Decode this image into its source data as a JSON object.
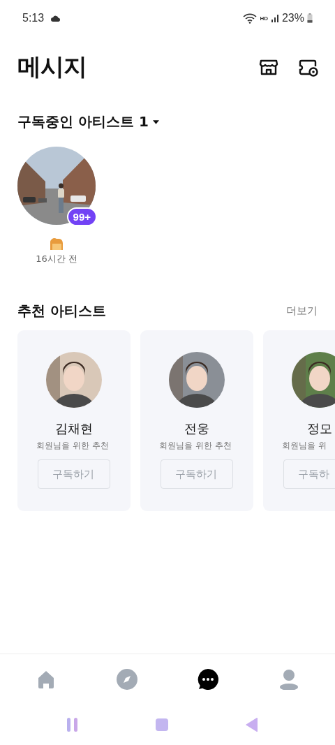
{
  "status_bar": {
    "time": "5:13",
    "hd_label": "HD",
    "battery": "23%"
  },
  "header": {
    "title": "메시지"
  },
  "subscribed": {
    "title": "구독중인 아티스트 1",
    "artists": [
      {
        "kind": "picture",
        "badge": "99+",
        "time": "16시간 전"
      }
    ]
  },
  "recommended": {
    "title": "추천 아티스트",
    "more": "더보기",
    "artists": [
      {
        "name": "김채현",
        "subtitle": "회원님을 위한 추천",
        "button": "구독하기"
      },
      {
        "name": "전웅",
        "subtitle": "회원님을 위한 추천",
        "button": "구독하기"
      },
      {
        "name": "정모",
        "subtitle": "회원님을 위",
        "button": "구독하"
      }
    ]
  },
  "bottom_nav": [
    {
      "kind": "home",
      "selected": false
    },
    {
      "kind": "explore",
      "selected": false
    },
    {
      "kind": "messages",
      "selected": true
    },
    {
      "kind": "profile",
      "selected": false
    }
  ]
}
